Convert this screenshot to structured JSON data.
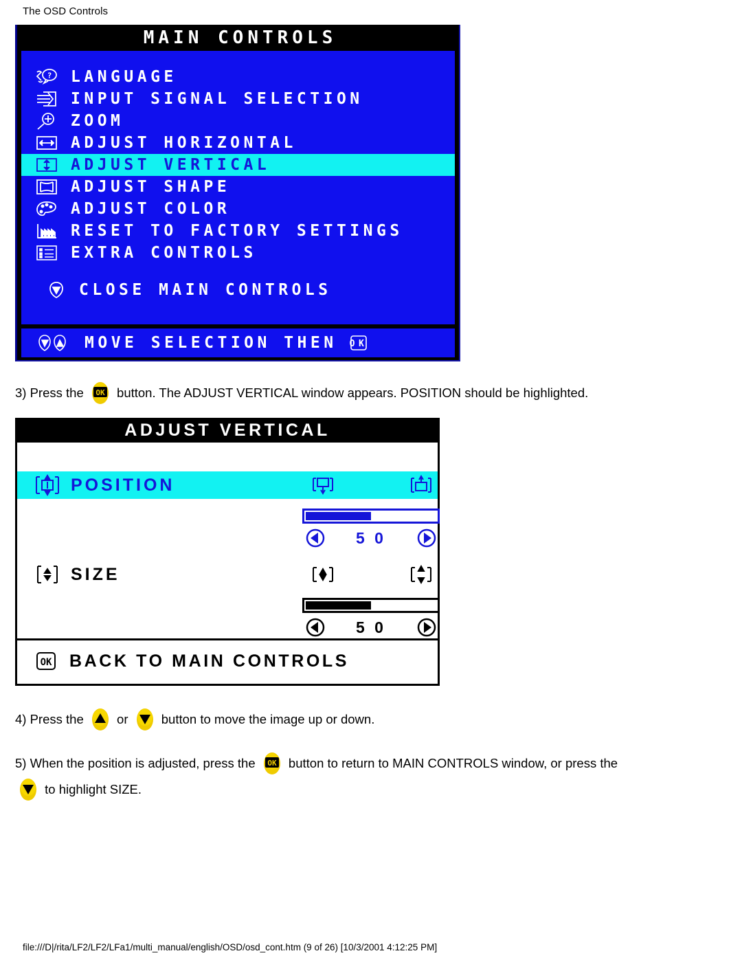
{
  "page": {
    "title": "The OSD Controls",
    "footer": "file:///D|/rita/LF2/LF2/LFa1/multi_manual/english/OSD/osd_cont.htm (9 of 26) [10/3/2001 4:12:25 PM]"
  },
  "colors": {
    "osd_blue": "#1010EE",
    "osd_highlight_cyan": "#12F2F2",
    "osd_text_white": "#FFFFFF",
    "osd_text_blue": "#1515D8",
    "button_yellow": "#EFCB00",
    "black": "#000000",
    "white": "#FFFFFF"
  },
  "main_controls": {
    "title": "MAIN CONTROLS",
    "items": [
      {
        "label": "LANGUAGE",
        "icon": "language-icon",
        "selected": false
      },
      {
        "label": "INPUT SIGNAL SELECTION",
        "icon": "input-signal-icon",
        "selected": false
      },
      {
        "label": "ZOOM",
        "icon": "zoom-magnifier-icon",
        "selected": false
      },
      {
        "label": "ADJUST HORIZONTAL",
        "icon": "horizontal-arrows-icon",
        "selected": false
      },
      {
        "label": "ADJUST VERTICAL",
        "icon": "vertical-arrows-icon",
        "selected": true
      },
      {
        "label": "ADJUST SHAPE",
        "icon": "shape-icon",
        "selected": false
      },
      {
        "label": "ADJUST COLOR",
        "icon": "palette-icon",
        "selected": false
      },
      {
        "label": "RESET TO FACTORY SETTINGS",
        "icon": "factory-icon",
        "selected": false
      },
      {
        "label": "EXTRA CONTROLS",
        "icon": "list-icon",
        "selected": false
      }
    ],
    "close_item": {
      "label": "CLOSE MAIN CONTROLS",
      "icon": "down-arrow-badge-icon"
    },
    "footer_hint": {
      "label": "MOVE SELECTION THEN",
      "icons": [
        "down-arrow-badge-icon",
        "up-arrow-badge-icon"
      ],
      "trailing_icon": "ok-key-icon"
    }
  },
  "adjust_vertical": {
    "title": "ADJUST VERTICAL",
    "rows": [
      {
        "label": "POSITION",
        "icon": "position-vertical-icon",
        "selected": true,
        "right_icons": [
          "move-down-icon",
          "move-up-icon"
        ],
        "slider": {
          "value": "5 0",
          "fill_percent": 50,
          "left_arrow": "left-arrow-icon",
          "right_arrow": "right-arrow-icon"
        }
      },
      {
        "label": "SIZE",
        "icon": "size-vertical-icon",
        "selected": false,
        "right_icons": [
          "shrink-vertical-icon",
          "grow-vertical-icon"
        ],
        "slider": {
          "value": "5 0",
          "fill_percent": 50,
          "left_arrow": "left-arrow-icon",
          "right_arrow": "right-arrow-icon"
        }
      }
    ],
    "back_item": {
      "label": "BACK TO MAIN CONTROLS",
      "icon": "ok-key-icon"
    }
  },
  "instructions": [
    {
      "id": "step3",
      "parts": [
        {
          "type": "text",
          "value": "3) Press the "
        },
        {
          "type": "icon",
          "value": "ok-button-icon"
        },
        {
          "type": "text",
          "value": " button. The ADJUST VERTICAL window appears. POSITION should be highlighted."
        }
      ]
    },
    {
      "id": "step4",
      "parts": [
        {
          "type": "text",
          "value": "4) Press the "
        },
        {
          "type": "icon",
          "value": "up-button-icon"
        },
        {
          "type": "text",
          "value": " or "
        },
        {
          "type": "icon",
          "value": "down-button-icon"
        },
        {
          "type": "text",
          "value": " button to move the image up or down."
        }
      ]
    },
    {
      "id": "step5a",
      "parts": [
        {
          "type": "text",
          "value": "5) When the position is adjusted, press the "
        },
        {
          "type": "icon",
          "value": "ok-button-icon"
        },
        {
          "type": "text",
          "value": " button to return to MAIN CONTROLS window, or press the"
        }
      ]
    },
    {
      "id": "step5b",
      "parts": [
        {
          "type": "icon",
          "value": "down-button-icon"
        },
        {
          "type": "text",
          "value": " to highlight SIZE."
        }
      ]
    }
  ],
  "text": {
    "step3_a": "3) Press the ",
    "step3_b": " button. The ADJUST VERTICAL window appears. POSITION should be highlighted.",
    "step4_a": "4) Press the ",
    "step4_b": " or ",
    "step4_c": " button to move the image up or down.",
    "step5_a": "5) When the position is adjusted, press the ",
    "step5_b": " button to return to MAIN CONTROLS window, or press the",
    "step5_c": " to highlight SIZE."
  }
}
